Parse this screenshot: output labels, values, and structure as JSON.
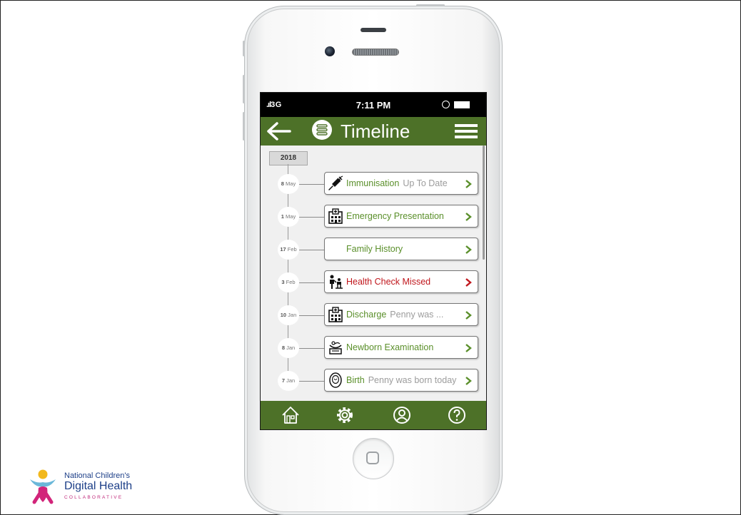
{
  "status_bar": {
    "signal": "3G",
    "time": "7:11 PM"
  },
  "nav": {
    "title": "Timeline"
  },
  "year_label": "2018",
  "timeline": [
    {
      "day": "8",
      "month": "May",
      "title": "Immunisation",
      "subtitle": "Up To Date",
      "icon": "syringe-icon",
      "status": "normal"
    },
    {
      "day": "1",
      "month": "May",
      "title": "Emergency Presentation",
      "subtitle": "",
      "icon": "hospital-icon",
      "status": "normal"
    },
    {
      "day": "17",
      "month": "Feb",
      "title": "Family History",
      "subtitle": "",
      "icon": "",
      "status": "normal"
    },
    {
      "day": "3",
      "month": "Feb",
      "title": "Health Check Missed",
      "subtitle": "",
      "icon": "health-check-icon",
      "status": "alert"
    },
    {
      "day": "10",
      "month": "Jan",
      "title": "Discharge",
      "subtitle": "Penny was ...",
      "icon": "hospital-icon",
      "status": "normal"
    },
    {
      "day": "8",
      "month": "Jan",
      "title": "Newborn Examination",
      "subtitle": "",
      "icon": "baby-scale-icon",
      "status": "normal"
    },
    {
      "day": "7",
      "month": "Jan",
      "title": "Birth",
      "subtitle": "Penny was born today",
      "icon": "baby-icon",
      "status": "normal"
    }
  ],
  "tabs": [
    {
      "name": "home",
      "icon": "home-icon"
    },
    {
      "name": "settings",
      "icon": "gear-icon"
    },
    {
      "name": "profile",
      "icon": "profile-icon"
    },
    {
      "name": "help",
      "icon": "help-icon"
    }
  ],
  "colors": {
    "brand_green": "#4d7128",
    "item_green": "#5a8f2a",
    "alert_red": "#c0161c"
  },
  "logo": {
    "line1": "National Children's",
    "line2": "Digital Health",
    "line3": "COLLABORATIVE"
  }
}
